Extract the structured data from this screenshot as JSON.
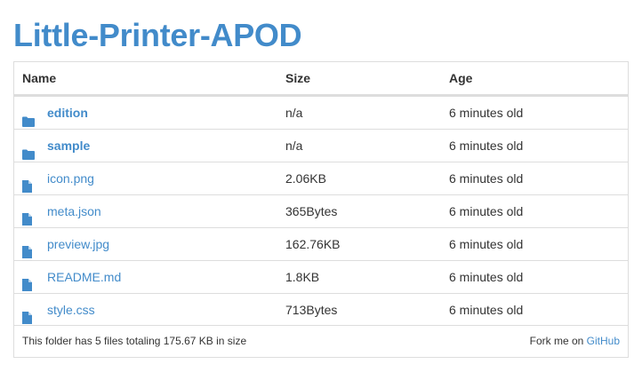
{
  "page": {
    "title": "Little-Printer-APOD"
  },
  "listing": {
    "headers": {
      "name": "Name",
      "size": "Size",
      "age": "Age"
    },
    "rows": [
      {
        "name": "edition",
        "type": "folder",
        "size": "n/a",
        "age": "6 minutes old"
      },
      {
        "name": "sample",
        "type": "folder",
        "size": "n/a",
        "age": "6 minutes old"
      },
      {
        "name": "icon.png",
        "type": "file",
        "size": "2.06KB",
        "age": "6 minutes old"
      },
      {
        "name": "meta.json",
        "type": "file",
        "size": "365Bytes",
        "age": "6 minutes old"
      },
      {
        "name": "preview.jpg",
        "type": "file",
        "size": "162.76KB",
        "age": "6 minutes old"
      },
      {
        "name": "README.md",
        "type": "file",
        "size": "1.8KB",
        "age": "6 minutes old"
      },
      {
        "name": "style.css",
        "type": "file",
        "size": "713Bytes",
        "age": "6 minutes old"
      }
    ]
  },
  "footer": {
    "summary": "This folder has 5 files totaling 175.67 KB in size",
    "fork_prefix": "Fork me on",
    "fork_link": "GitHub"
  },
  "colors": {
    "accent": "#428bca",
    "border": "#dddddd",
    "text": "#333333"
  },
  "icons": {
    "folder": "folder-icon",
    "file": "file-icon"
  }
}
